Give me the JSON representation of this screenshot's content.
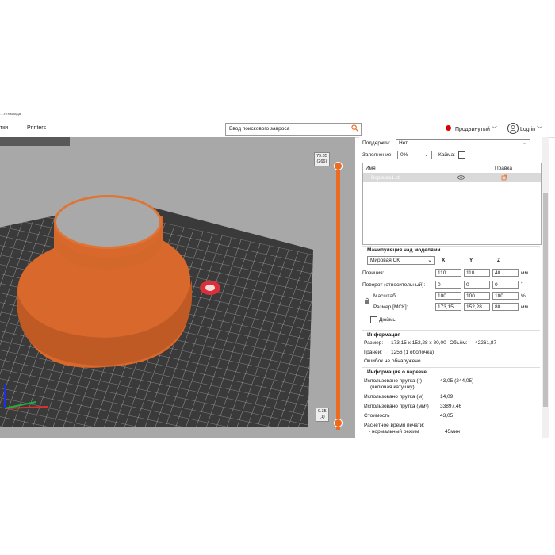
{
  "window": {
    "title_fragment": "…нтеклада"
  },
  "nav": {
    "tab_partial": "тки",
    "printers": "Printers"
  },
  "search": {
    "placeholder": "Ввод поискового запроса"
  },
  "mode": {
    "label": "Продвинутый",
    "status_color": "#dd0000"
  },
  "account": {
    "label": "Log in"
  },
  "accent_color": "#ed6b21",
  "settings": {
    "supports_label": "Поддержки:",
    "supports_value": "Нет",
    "infill_label": "Заполнение:",
    "infill_value": "0%",
    "brim_label": "Кайма:"
  },
  "object_list": {
    "col_name": "Имя",
    "col_edit": "Правка",
    "row_name": "Воронка1.stl"
  },
  "manipulation": {
    "title": "Манипуляция над моделями",
    "cs": "Мировая СК",
    "axis_x": "X",
    "axis_y": "Y",
    "axis_z": "Z",
    "position_label": "Позиция:",
    "position": [
      "110",
      "110",
      "40"
    ],
    "position_unit": "мм",
    "rotation_label": "Поворот (относительный):",
    "rotation": [
      "0",
      "0",
      "0"
    ],
    "rotation_unit": "°",
    "scale_label": "Масштаб:",
    "scale": [
      "100",
      "100",
      "100"
    ],
    "scale_unit": "%",
    "size_label": "Размер [МСК]:",
    "size": [
      "173,15",
      "152,28",
      "80"
    ],
    "size_unit": "мм",
    "inches_label": "Дюймы"
  },
  "info": {
    "title": "Информация",
    "size_label": "Размер:",
    "size_value": "173,15 x 152,28 x 80,00",
    "volume_label": "Объём:",
    "volume_value": "42261,87",
    "facets_label": "Граней:",
    "facets_value": "1256 (1 оболочка)",
    "errors": "Ошибок не обнаружено"
  },
  "slice_info": {
    "title": "Информация о нарезке",
    "used_g_label": "Использовано прутка (г)",
    "used_g_sub": "(включая катушку)",
    "used_g_value": "43,05 (244,05)",
    "used_m_label": "Использовано прутка (м)",
    "used_m_value": "14,09",
    "used_mm3_label": "Использовано прутка (мм³)",
    "used_mm3_value": "33897,46",
    "cost_label": "Стоимость",
    "cost_value": "43,05",
    "time_label": "Расчётное время печати:",
    "time_mode": "- нормальный режим",
    "time_value": "45мин"
  },
  "layer_slider": {
    "top_value": "79.85",
    "top_layer": "(266)",
    "bottom_value": "0.35",
    "bottom_layer": "(1)"
  }
}
